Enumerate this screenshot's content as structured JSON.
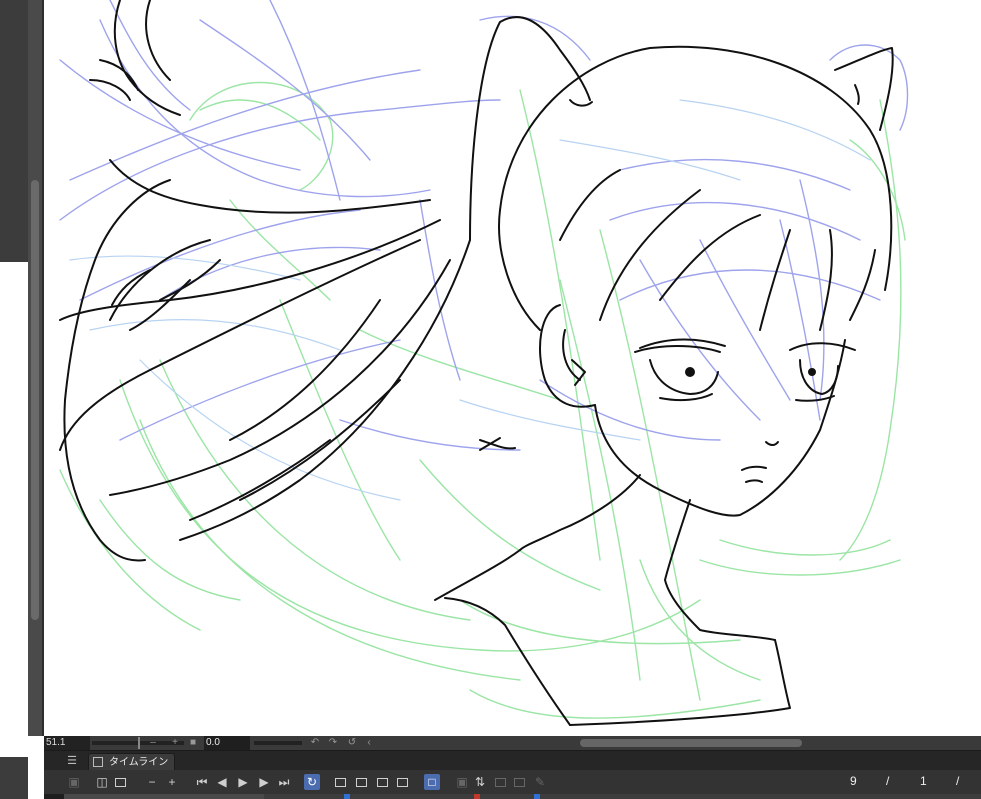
{
  "status": {
    "zoom_value": "51.1",
    "zoom_minus": "–",
    "zoom_plus": "+",
    "zoom_fit": "■",
    "angle_value": "0.0",
    "rotate_left": "↶",
    "rotate_right": "↷",
    "rotate_reset": "↺",
    "scroll_left": "‹"
  },
  "timeline": {
    "menu_icon": "☰",
    "tab_label": "タイムライン",
    "frame_current": "9",
    "frame_sep": "/",
    "frame_total": "1",
    "toolbar": {
      "new_timeline": "▣",
      "props": "◫",
      "zoom_out": "−",
      "zoom_in": "+",
      "first": "⏮",
      "prev": "◀",
      "play": "▶",
      "next": "▶",
      "last": "⏭",
      "loop": "↻",
      "onion": "□",
      "light_table": "▣",
      "transform": "⇅",
      "pen": "✎"
    },
    "ruler_colors": [
      "#2f6fd6",
      "#c0392b",
      "#2f6fd6"
    ]
  },
  "colors": {
    "lineart": "#111111",
    "blue_sketch": "#9ea3ec",
    "light_blue_sketch": "#b7d3f2",
    "green_sketch": "#9be5a5",
    "toolbar_bg": "#333333",
    "status_bg": "#3a3a3a"
  }
}
